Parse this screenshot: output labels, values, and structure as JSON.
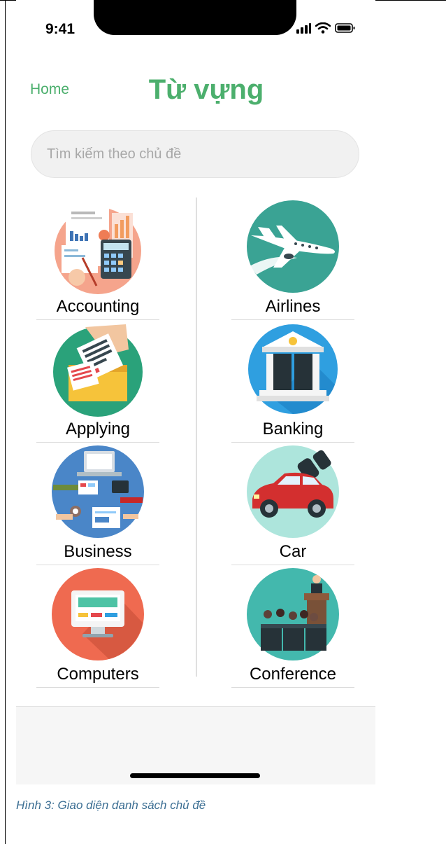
{
  "status_bar": {
    "time": "9:41"
  },
  "header": {
    "home_link": "Home",
    "title": "Từ vựng"
  },
  "search": {
    "placeholder": "Tìm kiếm theo chủ đề",
    "value": ""
  },
  "topics": [
    {
      "label": "Accounting",
      "icon": "accounting-icon",
      "bg": "#f4a58e"
    },
    {
      "label": "Airlines",
      "icon": "airplane-icon",
      "bg": "#3aa394"
    },
    {
      "label": "Applying",
      "icon": "application-box-icon",
      "bg": "#2aa27a"
    },
    {
      "label": "Banking",
      "icon": "bank-icon",
      "bg": "#2f9fe0"
    },
    {
      "label": "Business",
      "icon": "business-meeting-icon",
      "bg": "#4a86c8"
    },
    {
      "label": "Car",
      "icon": "car-icon",
      "bg": "#ade5dc"
    },
    {
      "label": "Computers",
      "icon": "computer-icon",
      "bg": "#ef6a50"
    },
    {
      "label": "Conference",
      "icon": "conference-icon",
      "bg": "#43b8ad"
    }
  ],
  "caption": "Hình 3: Giao diện danh sách chủ đề"
}
